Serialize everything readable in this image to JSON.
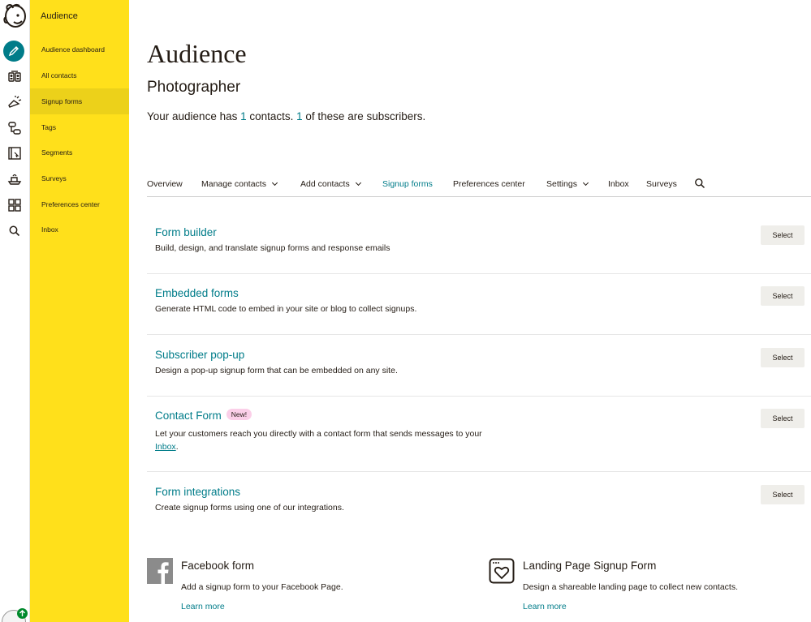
{
  "subnav": {
    "title": "Audience",
    "items": [
      {
        "label": "Audience dashboard"
      },
      {
        "label": "All contacts"
      },
      {
        "label": "Signup forms"
      },
      {
        "label": "Tags"
      },
      {
        "label": "Segments"
      },
      {
        "label": "Surveys"
      },
      {
        "label": "Preferences center"
      },
      {
        "label": "Inbox"
      }
    ]
  },
  "rail": {
    "icons": [
      "mailchimp-logo",
      "pencil-icon",
      "audience-icon",
      "campaigns-icon",
      "automations-icon",
      "website-icon",
      "integrations-icon",
      "grid-icon",
      "search-icon"
    ]
  },
  "header": {
    "title": "Audience",
    "audience_name": "Photographer",
    "summary_prefix": "Your audience has ",
    "contacts_count": "1",
    "summary_middle": " contacts. ",
    "subscribers_count": "1",
    "summary_suffix": " of these are subscribers."
  },
  "tabs": [
    {
      "label": "Overview"
    },
    {
      "label": "Manage contacts"
    },
    {
      "label": "Add contacts"
    },
    {
      "label": "Signup forms"
    },
    {
      "label": "Preferences center"
    },
    {
      "label": "Settings"
    },
    {
      "label": "Inbox"
    },
    {
      "label": "Surveys"
    }
  ],
  "forms": [
    {
      "title": "Form builder",
      "description": "Build, design, and translate signup forms and response emails",
      "button": "Select"
    },
    {
      "title": "Embedded forms",
      "description": "Generate HTML code to embed in your site or blog to collect signups.",
      "button": "Select"
    },
    {
      "title": "Subscriber pop-up",
      "description": "Design a pop-up signup form that can be embedded on any site.",
      "button": "Select"
    },
    {
      "title": "Contact Form",
      "badge": "New!",
      "description": "Let your customers reach you directly with a contact form that sends messages to your ",
      "description_link": "Inbox",
      "description_end": ".",
      "button": "Select"
    },
    {
      "title": "Form integrations",
      "description": "Create signup forms using one of our integrations.",
      "button": "Select"
    }
  ],
  "cards": [
    {
      "title": "Facebook form",
      "description": "Add a signup form to your Facebook Page.",
      "link": "Learn more"
    },
    {
      "title": "Landing Page Signup Form",
      "description": "Design a shareable landing page to collect new contacts.",
      "link": "Learn more"
    }
  ],
  "colors": {
    "accent": "#007c89",
    "sidebar": "#ffe01b",
    "sidebar_active": "#ecd11a",
    "badge": "#fbcfe8"
  }
}
